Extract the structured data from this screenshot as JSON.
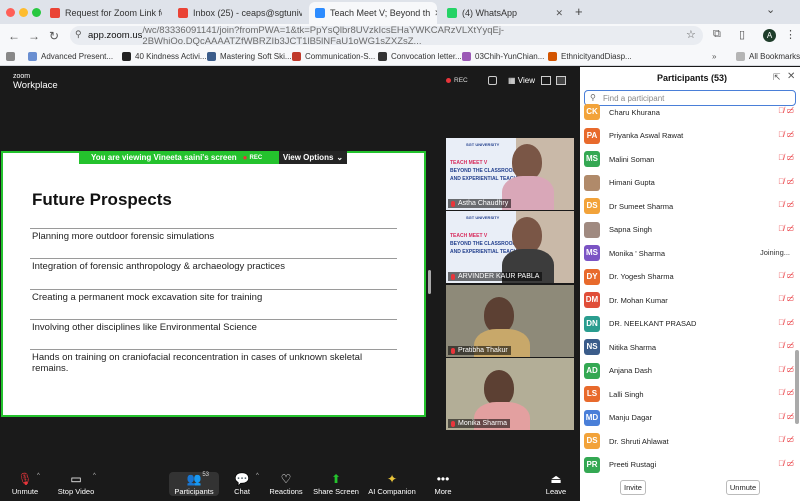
{
  "browser": {
    "tabs": [
      {
        "title": "Request for Zoom Link for Te",
        "color": "#ea4335"
      },
      {
        "title": "Inbox (25) - ceaps@sgtunive",
        "color": "#ea4335"
      },
      {
        "title": "Teach Meet V; Beyond th",
        "color": "#2d8cff"
      },
      {
        "title": "(4) WhatsApp",
        "color": "#25d366"
      }
    ],
    "url_domain": "app.zoom.us",
    "url_rest": "/wc/83336091141/join?fromPWA=1&tk=PpYsQlbr8UVzkIcsEHaYWKCARzVLXtYyqEj-2BWhiOo.DQcAAAATZfWBRZIb3JCT1lB5lNFaU1oWG1sZXZsZ...",
    "bookmarks": [
      "Advanced Present...",
      "40 Kindness Activi...",
      "Mastering Soft Ski...",
      "Communication-S...",
      "Convocation letter...",
      "03Chih-YunChian...",
      "EthnicityandDiasp..."
    ],
    "all_bookmarks": "All Bookmarks",
    "avatar_letter": "A",
    "new_tab": "+",
    "more_bookmarks": "»"
  },
  "zoom": {
    "logo_top": "zoom",
    "logo_bottom": "Workplace",
    "rec_label": "REC",
    "view_label": "View",
    "sharing_banner": "You are viewing  Vineeta saini's screen",
    "banner_rec": "REC",
    "view_options": "View Options",
    "slide": {
      "title": "Future Prospects",
      "items": [
        "Planning more outdoor forensic simulations",
        "Integration of forensic anthropology & archaeology practices",
        "Creating a permanent mock excavation site for training",
        "Involving other disciplines like Environmental Science",
        "Hands on training on craniofacial reconcentration in cases of unknown skeletal remains."
      ]
    },
    "video_tiles": [
      {
        "name": "Astha Chaudhry",
        "poster": true
      },
      {
        "name": "ARVINDER KAUR PABLA",
        "poster": true
      },
      {
        "name": "Pratibha Thakur",
        "poster": false
      },
      {
        "name": "Monika Sharma",
        "poster": false
      }
    ],
    "poster_text": {
      "org": "SGT UNIVERSITY",
      "line0": "TEACH MEET V",
      "line1": "BEYOND THE CLASSROOM:",
      "line2": "AND EXPERIENTIAL TEACHI"
    },
    "toolbar": [
      {
        "label": "Unmute",
        "icon": "mic-off-icon",
        "glyph": "🎙"
      },
      {
        "label": "Stop Video",
        "icon": "video-icon",
        "glyph": "▭"
      },
      {
        "label": "Participants",
        "icon": "participants-icon",
        "glyph": "👥",
        "badge": "53"
      },
      {
        "label": "Chat",
        "icon": "chat-icon",
        "glyph": "💬"
      },
      {
        "label": "Reactions",
        "icon": "heart-icon",
        "glyph": "♡"
      },
      {
        "label": "Share Screen",
        "icon": "share-screen-icon",
        "glyph": "⬆"
      },
      {
        "label": "AI Companion",
        "icon": "sparkle-icon",
        "glyph": "✦"
      },
      {
        "label": "More",
        "icon": "more-icon",
        "glyph": "•••"
      },
      {
        "label": "Leave",
        "icon": "leave-icon",
        "glyph": "⏏"
      }
    ]
  },
  "participants": {
    "title": "Participants (53)",
    "search_placeholder": "Find a participant",
    "list": [
      {
        "initials": "CK",
        "name": "Charu Khurana",
        "color": "#f2a33a",
        "status": ""
      },
      {
        "initials": "PA",
        "name": "Priyanka Aswal Rawat",
        "color": "#e86a2c",
        "status": ""
      },
      {
        "initials": "MS",
        "name": "Malini Soman",
        "color": "#34a853",
        "status": ""
      },
      {
        "initials": "",
        "name": "Himani Gupta",
        "color": "#b08a6a",
        "status": ""
      },
      {
        "initials": "DS",
        "name": "Dr Sumeet Sharma",
        "color": "#f2a33a",
        "status": ""
      },
      {
        "initials": "",
        "name": "Sapna Singh",
        "color": "#a08a80",
        "status": ""
      },
      {
        "initials": "MS",
        "name": "Monika ' Sharma",
        "color": "#7b54c4",
        "status": "Joining..."
      },
      {
        "initials": "DY",
        "name": "Dr. Yogesh Sharma",
        "color": "#e86a2c",
        "status": ""
      },
      {
        "initials": "DM",
        "name": "Dr. Mohan Kumar",
        "color": "#e04e39",
        "status": ""
      },
      {
        "initials": "DN",
        "name": "DR. NEELKANT PRASAD",
        "color": "#2a9d8f",
        "status": ""
      },
      {
        "initials": "NS",
        "name": "Nitika Sharma",
        "color": "#3b5c8a",
        "status": ""
      },
      {
        "initials": "AD",
        "name": "Anjana Dash",
        "color": "#34a853",
        "status": ""
      },
      {
        "initials": "LS",
        "name": "Lalli Singh",
        "color": "#e86a2c",
        "status": ""
      },
      {
        "initials": "MD",
        "name": "Manju Dagar",
        "color": "#4a7fd8",
        "status": ""
      },
      {
        "initials": "DS",
        "name": "Dr. Shruti Ahlawat",
        "color": "#f2a33a",
        "status": ""
      },
      {
        "initials": "PR",
        "name": "Preeti Rustagi",
        "color": "#34a853",
        "status": ""
      }
    ],
    "invite": "Invite",
    "unmute": "Unmute"
  }
}
